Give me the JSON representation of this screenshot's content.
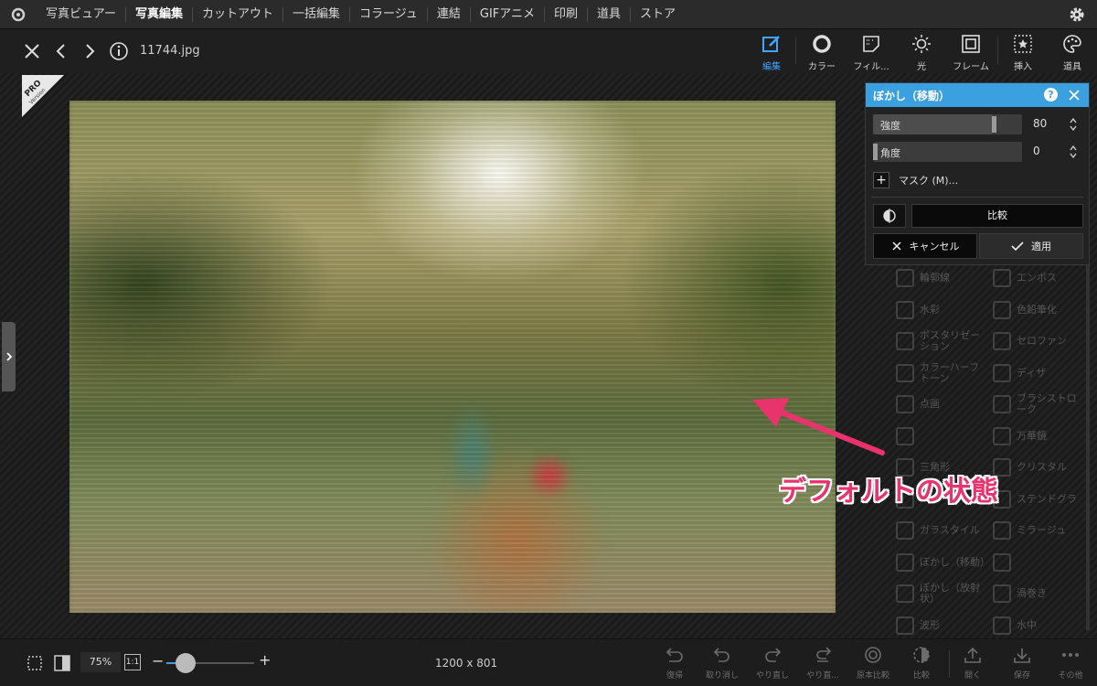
{
  "menu": {
    "items": [
      "写真ビュアー",
      "写真編集",
      "カットアウト",
      "一括編集",
      "コラージュ",
      "連結",
      "GIFアニメ",
      "印刷",
      "道具",
      "ストア"
    ],
    "active_index": 1
  },
  "toolbar": {
    "filename": "11744.jpg",
    "tools": [
      {
        "label": "編集",
        "icon": "edit-icon",
        "active": true
      },
      {
        "label": "カラー",
        "icon": "color-icon"
      },
      {
        "label": "フィル...",
        "icon": "filter-icon"
      },
      {
        "label": "光",
        "icon": "light-icon"
      },
      {
        "label": "フレーム",
        "icon": "frame-icon"
      },
      {
        "label": "挿入",
        "icon": "insert-icon"
      },
      {
        "label": "道具",
        "icon": "tools-icon"
      }
    ]
  },
  "badge": {
    "pro": "PRO",
    "version": "Version"
  },
  "annotation": {
    "text": "デフォルトの状態",
    "color": "#e8336d"
  },
  "dialog": {
    "title": "ぼかし（移動）",
    "help": "?",
    "sliders": [
      {
        "label": "強度",
        "value": "80",
        "level": 0.8
      },
      {
        "label": "角度",
        "value": "0",
        "level": 0.0
      }
    ],
    "mask_label": "マスク (M)...",
    "compare_label": "比較",
    "cancel_label": "キャンセル",
    "apply_label": "適用",
    "accent_color": "#3aa0df"
  },
  "effects": [
    {
      "label": "輪郭線"
    },
    {
      "label": "エンボス"
    },
    {
      "label": "水彩"
    },
    {
      "label": "色鉛筆化"
    },
    {
      "label": "ポスタリゼーション"
    },
    {
      "label": "セロファン"
    },
    {
      "label": "カラーハーフトーン"
    },
    {
      "label": "ディザ"
    },
    {
      "label": "点画"
    },
    {
      "label": "ブラシストローク"
    },
    {
      "label": ""
    },
    {
      "label": "万華鏡"
    },
    {
      "label": "三角形"
    },
    {
      "label": "クリスタル"
    },
    {
      "label": ""
    },
    {
      "label": "ステンドグラ"
    },
    {
      "label": "ガラスタイル"
    },
    {
      "label": "ミラージュ"
    },
    {
      "label": "ぼかし（移動）"
    },
    {
      "label": ""
    },
    {
      "label": "ぼかし（放射状）"
    },
    {
      "label": "渦巻き"
    },
    {
      "label": "波形"
    },
    {
      "label": "水中"
    }
  ],
  "bottom": {
    "zoom": "75%",
    "one_to_one": "1:1",
    "zoom_level": 0.22,
    "dimensions": "1200 x 801",
    "actions": [
      "復帰",
      "取り消し",
      "やり直し",
      "やり直...",
      "原本比較",
      "比較",
      "開く",
      "保存",
      "その他"
    ]
  }
}
